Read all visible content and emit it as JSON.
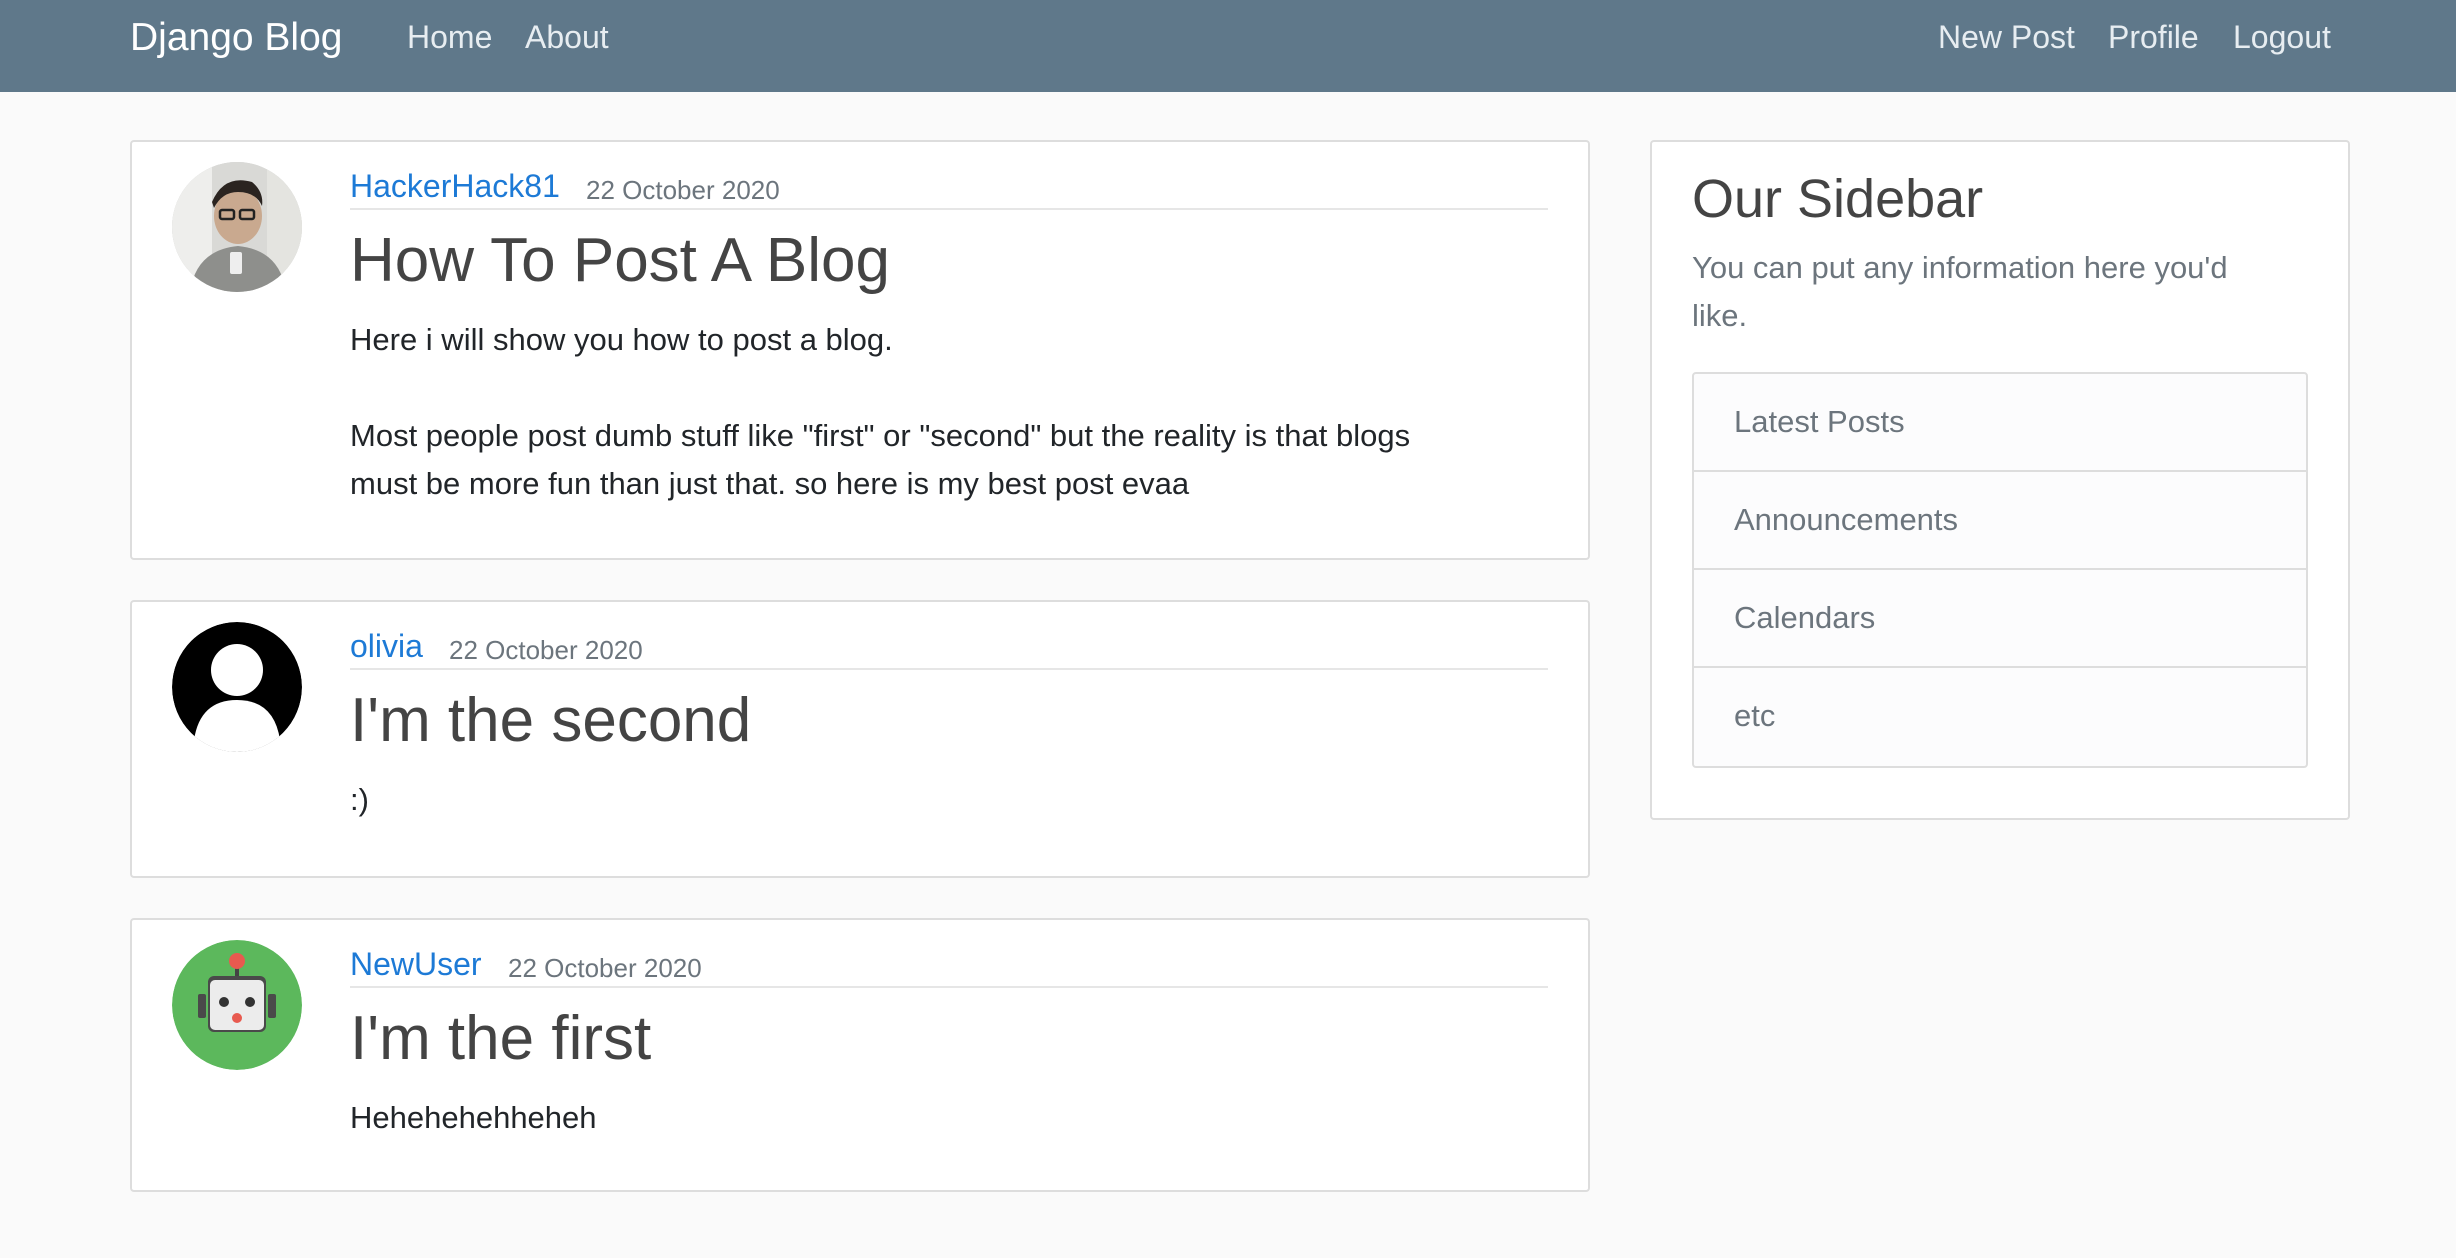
{
  "navbar": {
    "brand": "Django Blog",
    "left_links": [
      "Home",
      "About"
    ],
    "right_links": [
      "New Post",
      "Profile",
      "Logout"
    ]
  },
  "posts": [
    {
      "author": "HackerHack81",
      "date": "22 October 2020",
      "title": "How To Post A Blog",
      "body_lines": [
        "Here i will show you how to post a blog.",
        "",
        "Most people post dumb stuff like \"first\" or \"second\" but the reality is that blogs",
        "must be more fun than just that. so here is my best post evaa"
      ],
      "avatar": "photo-avatar-icon"
    },
    {
      "author": "olivia",
      "date": "22 October 2020",
      "title": "I'm the second",
      "body_lines": [
        ":)"
      ],
      "avatar": "default-user-avatar-icon"
    },
    {
      "author": "NewUser",
      "date": "22 October 2020",
      "title": "I'm the first",
      "body_lines": [
        "Hehehehehheheh"
      ],
      "avatar": "robot-avatar-icon"
    }
  ],
  "sidebar": {
    "title": "Our Sidebar",
    "text_lines": [
      "You can put any information here you'd",
      "like."
    ],
    "items": [
      "Latest Posts",
      "Announcements",
      "Calendars",
      "etc"
    ]
  },
  "colors": {
    "navbar": "#5f788a",
    "link": "#1d7ad6",
    "background": "#fafafa"
  }
}
